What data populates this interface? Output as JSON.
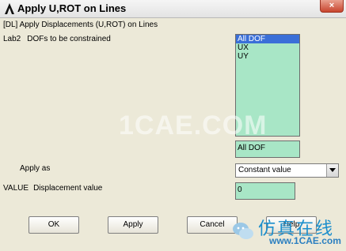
{
  "window": {
    "title": "Apply U,ROT on Lines",
    "close_label": "×"
  },
  "header": {
    "text": "[DL]  Apply Displacements (U,ROT) on Lines"
  },
  "lab2": {
    "key": "Lab2",
    "label": "DOFs to be constrained",
    "options": [
      "All DOF",
      "UX",
      "UY"
    ],
    "selected_index": 0,
    "selected_value": "All DOF"
  },
  "apply_as": {
    "label": "Apply as",
    "value": "Constant value"
  },
  "value": {
    "key": "VALUE",
    "label": "Displacement value",
    "field_value": "0"
  },
  "buttons": {
    "ok": "OK",
    "apply": "Apply",
    "cancel": "Cancel",
    "help": "Help"
  },
  "watermark": {
    "text": "1CAE.COM",
    "brand_cn": "仿真在线",
    "brand_en": "www.1CAE.com"
  },
  "colors": {
    "dialog_bg": "#ECE9D8",
    "field_bg": "#A8E6C6",
    "selection": "#3A6FD8",
    "brand": "#1B8ECC"
  }
}
